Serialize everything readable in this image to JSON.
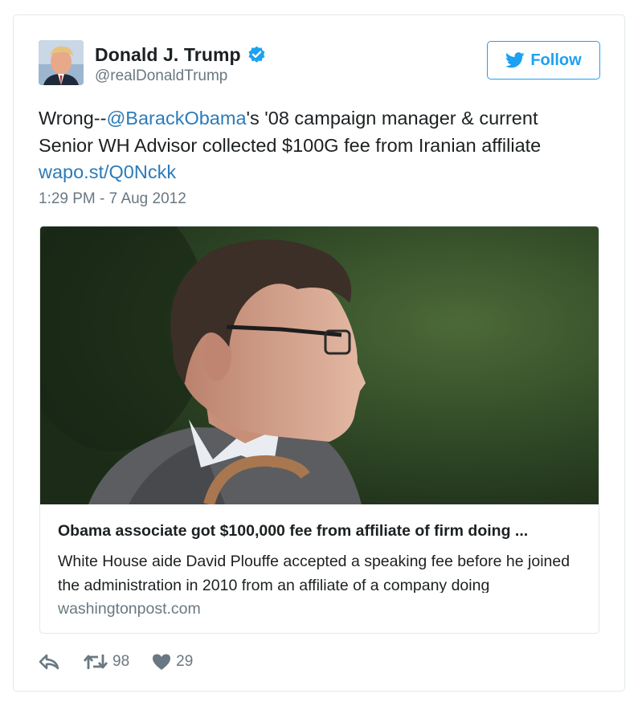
{
  "colors": {
    "accent": "#1da1f2",
    "link": "#2b7bb9",
    "secondary_text": "#697882",
    "border": "#e1e8ed"
  },
  "author": {
    "name": "Donald J. Trump",
    "handle": "@realDonaldTrump",
    "verified_icon": "verified-badge-icon"
  },
  "follow_button": {
    "label": "Follow",
    "icon": "twitter-bird-icon"
  },
  "tweet": {
    "prefix": "Wrong--",
    "mention": "@BarackObama",
    "body": "'s '08 campaign manager & current Senior WH Advisor collected $100G fee from Iranian affiliate",
    "link": "wapo.st/Q0Nckk",
    "timestamp": "1:29 PM - 7 Aug 2012"
  },
  "link_card": {
    "title": "Obama associate got $100,000 fee from affiliate of firm doing ...",
    "description": "White House aide David Plouffe accepted a speaking fee before he joined the administration in 2010 from an affiliate of a company doing",
    "domain": "washingtonpost.com"
  },
  "actions": {
    "reply_icon": "reply-icon",
    "retweet_icon": "retweet-icon",
    "retweet_count": "98",
    "like_icon": "heart-icon",
    "like_count": "29"
  }
}
